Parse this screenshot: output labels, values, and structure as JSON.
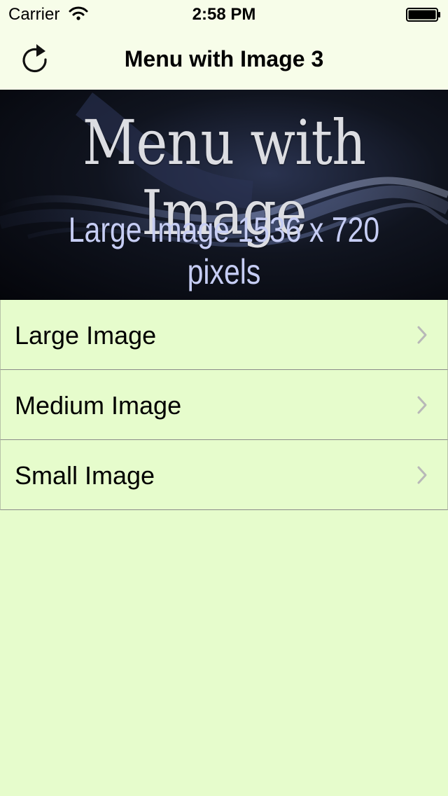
{
  "status_bar": {
    "carrier": "Carrier",
    "time": "2:58 PM"
  },
  "nav_bar": {
    "title": "Menu with Image 3",
    "refresh_icon": "refresh-icon"
  },
  "banner": {
    "title": "Menu with Image",
    "subtitle": "Large Image  1536 x 720 pixels"
  },
  "menu": {
    "items": [
      {
        "label": "Large Image"
      },
      {
        "label": "Medium Image"
      },
      {
        "label": "Small Image"
      }
    ]
  },
  "colors": {
    "background": "#e6fccc",
    "header_background": "#f7fde9",
    "separator": "#8a8a8a",
    "chevron": "#b8b8b8",
    "banner_subtitle": "#c6cdf4"
  }
}
